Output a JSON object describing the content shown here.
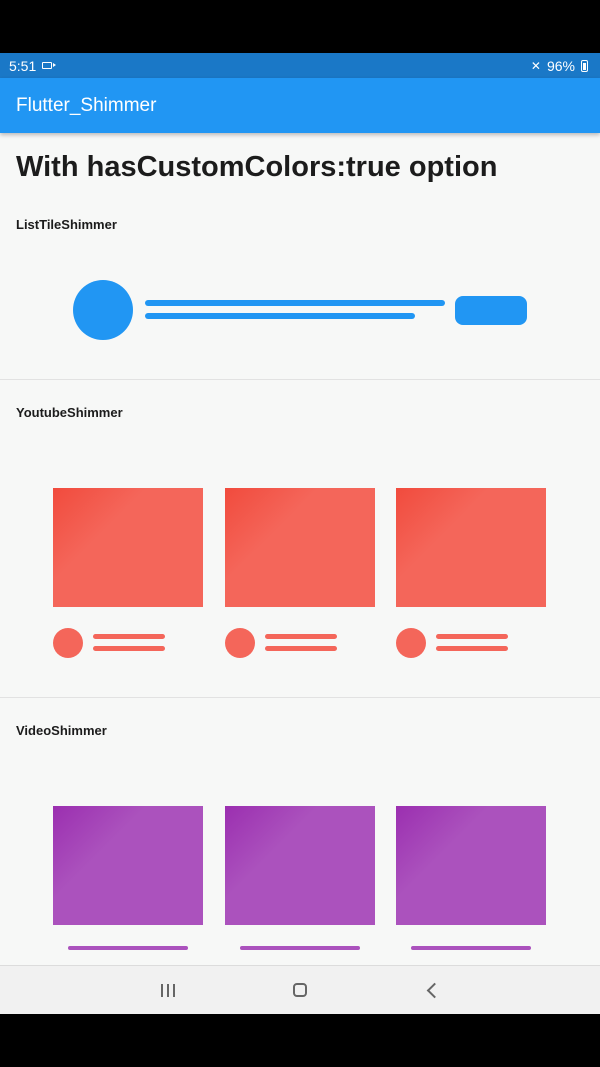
{
  "status_bar": {
    "time": "5:51",
    "battery": "96%",
    "icons": [
      "video-camera-icon",
      "mute-icon",
      "battery-icon"
    ]
  },
  "app_bar": {
    "title": "Flutter_Shimmer"
  },
  "heading": "With hasCustomColors:true option",
  "sections": {
    "list_tile": {
      "label": "ListTileShimmer",
      "color": "#2196f3"
    },
    "youtube": {
      "label": "YoutubeShimmer",
      "color": "#f4665a",
      "highlight": "#f14b3d",
      "card_count": 3
    },
    "video": {
      "label": "VideoShimmer",
      "color": "#ab52bd",
      "highlight": "#9b2fb0",
      "card_count": 3
    }
  },
  "nav_bar": {
    "icons": [
      "recent-apps-icon",
      "home-icon",
      "back-icon"
    ]
  },
  "colors": {
    "status_bar": "#1a78c7",
    "app_bar": "#2196f3",
    "background": "#f7f8f7"
  }
}
